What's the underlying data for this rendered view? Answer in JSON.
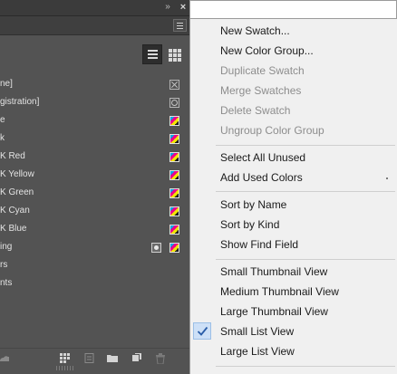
{
  "swatches_panel": {
    "rows": [
      {
        "name": "ne]",
        "icon": "none-swatch-icon"
      },
      {
        "name": "gistration]",
        "icon": "registration-swatch-icon"
      },
      {
        "name": "e",
        "icon": "cmyk-process-icon"
      },
      {
        "name": "k",
        "icon": "cmyk-process-icon"
      },
      {
        "name": "K Red",
        "icon": "cmyk-process-icon"
      },
      {
        "name": "K Yellow",
        "icon": "cmyk-process-icon"
      },
      {
        "name": "K Green",
        "icon": "cmyk-process-icon"
      },
      {
        "name": "K Cyan",
        "icon": "cmyk-process-icon"
      },
      {
        "name": "K Blue",
        "icon": "cmyk-process-icon"
      },
      {
        "name": "ing",
        "icon": "cmyk-process-icon",
        "spot": true
      },
      {
        "name": "rs",
        "icon": ""
      },
      {
        "name": "nts",
        "icon": ""
      }
    ],
    "view_buttons": [
      "list-view-icon",
      "grid-view-icon"
    ],
    "bottom_icons": [
      "swatch-views-icon",
      "color-group-icon",
      "folder-icon",
      "new-swatch-icon",
      "trash-icon"
    ]
  },
  "menu": {
    "items": [
      {
        "label": "New Swatch...",
        "enabled": true
      },
      {
        "label": "New Color Group...",
        "enabled": true
      },
      {
        "label": "Duplicate Swatch",
        "enabled": false
      },
      {
        "label": "Merge Swatches",
        "enabled": false
      },
      {
        "label": "Delete Swatch",
        "enabled": false
      },
      {
        "label": "Ungroup Color Group",
        "enabled": false
      },
      {
        "label": "Select All Unused",
        "enabled": true
      },
      {
        "label": "Add Used Colors",
        "enabled": true
      },
      {
        "label": "Sort by Name",
        "enabled": true
      },
      {
        "label": "Sort by Kind",
        "enabled": true
      },
      {
        "label": "Show Find Field",
        "enabled": true
      },
      {
        "label": "Small Thumbnail View",
        "enabled": true
      },
      {
        "label": "Medium Thumbnail View",
        "enabled": true
      },
      {
        "label": "Large Thumbnail View",
        "enabled": true
      },
      {
        "label": "Small List View",
        "enabled": true,
        "checked": true
      },
      {
        "label": "Large List View",
        "enabled": true
      }
    ]
  },
  "colors": {
    "panel_bg": "#535353",
    "menu_bg": "#f0f0f0",
    "check_highlight": "#cde0f7",
    "check_color": "#2a5da8"
  }
}
